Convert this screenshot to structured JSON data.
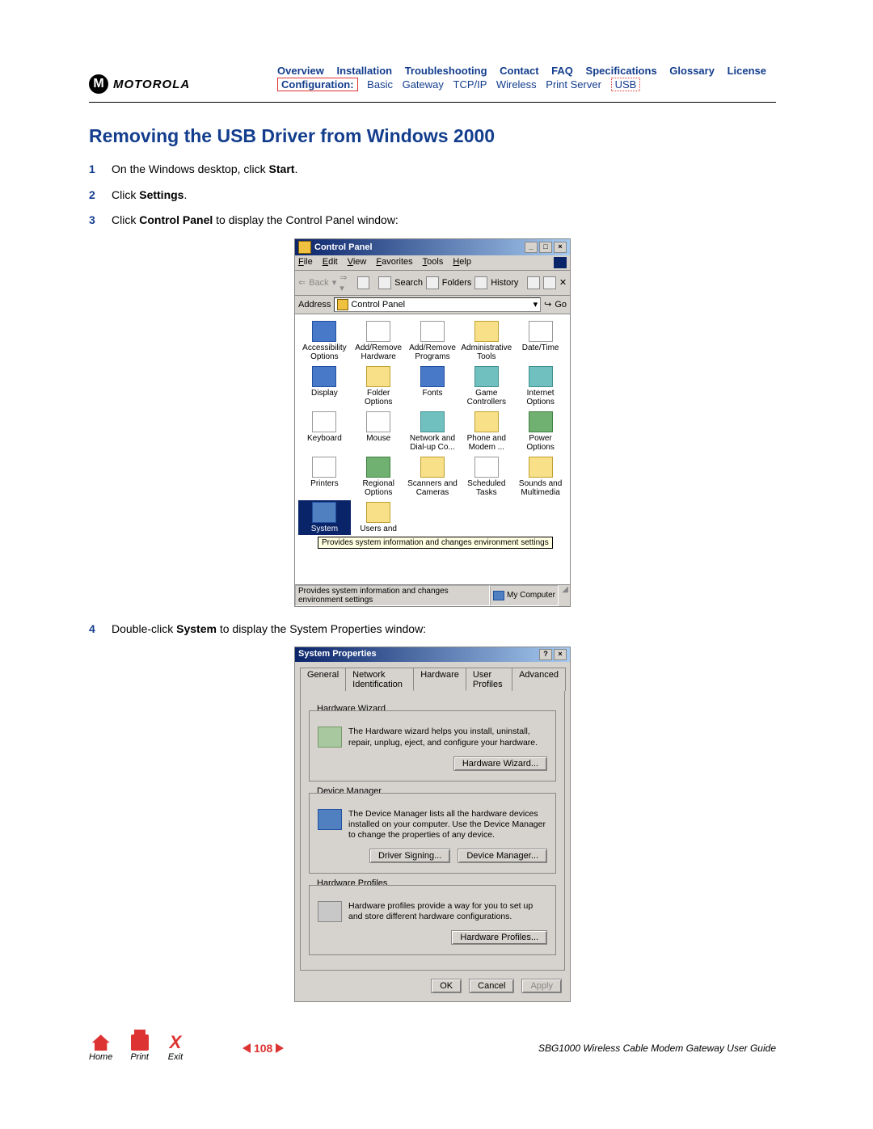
{
  "header": {
    "brand": "MOTOROLA",
    "nav1": [
      "Overview",
      "Installation",
      "Troubleshooting",
      "Contact",
      "FAQ",
      "Specifications",
      "Glossary",
      "License"
    ],
    "conf_label": "Configuration:",
    "nav2": [
      "Basic",
      "Gateway",
      "TCP/IP",
      "Wireless",
      "Print Server"
    ],
    "nav2_boxed": "USB"
  },
  "title": "Removing the USB Driver from Windows 2000",
  "steps": {
    "s1_pre": "On the Windows desktop, click ",
    "s1_b": "Start",
    "s1_post": ".",
    "s2_pre": "Click ",
    "s2_b": "Settings",
    "s2_post": ".",
    "s3_pre": "Click ",
    "s3_b": "Control Panel",
    "s3_post": " to display the Control Panel window:",
    "s4_pre": "Double-click ",
    "s4_b": "System",
    "s4_post": " to display the System Properties window:"
  },
  "cp": {
    "title": "Control Panel",
    "menu": [
      "File",
      "Edit",
      "View",
      "Favorites",
      "Tools",
      "Help"
    ],
    "back": "Back",
    "search": "Search",
    "folders": "Folders",
    "history": "History",
    "addr_label": "Address",
    "addr_value": "Control Panel",
    "go": "Go",
    "items": [
      "Accessibility Options",
      "Add/Remove Hardware",
      "Add/Remove Programs",
      "Administrative Tools",
      "Date/Time",
      "Display",
      "Folder Options",
      "Fonts",
      "Game Controllers",
      "Internet Options",
      "Keyboard",
      "Mouse",
      "Network and Dial-up Co...",
      "Phone and Modem ...",
      "Power Options",
      "Printers",
      "Regional Options",
      "Scanners and Cameras",
      "Scheduled Tasks",
      "Sounds and Multimedia",
      "System",
      "Users and"
    ],
    "tooltip": "Provides system information and changes environment settings",
    "status1": "Provides system information and changes environment settings",
    "status2": "My Computer"
  },
  "sp": {
    "title": "System Properties",
    "tabs": [
      "General",
      "Network Identification",
      "Hardware",
      "User Profiles",
      "Advanced"
    ],
    "g1_title": "Hardware Wizard",
    "g1_text": "The Hardware wizard helps you install, uninstall, repair, unplug, eject, and configure your hardware.",
    "g1_btn": "Hardware Wizard...",
    "g2_title": "Device Manager",
    "g2_text": "The Device Manager lists all the hardware devices installed on your computer. Use the Device Manager to change the properties of any device.",
    "g2_btn1": "Driver Signing...",
    "g2_btn2": "Device Manager...",
    "g3_title": "Hardware Profiles",
    "g3_text": "Hardware profiles provide a way for you to set up and store different hardware configurations.",
    "g3_btn": "Hardware Profiles...",
    "ok": "OK",
    "cancel": "Cancel",
    "apply": "Apply"
  },
  "footer": {
    "home": "Home",
    "print": "Print",
    "exit": "Exit",
    "page": "108",
    "guide": "SBG1000 Wireless Cable Modem Gateway User Guide"
  }
}
